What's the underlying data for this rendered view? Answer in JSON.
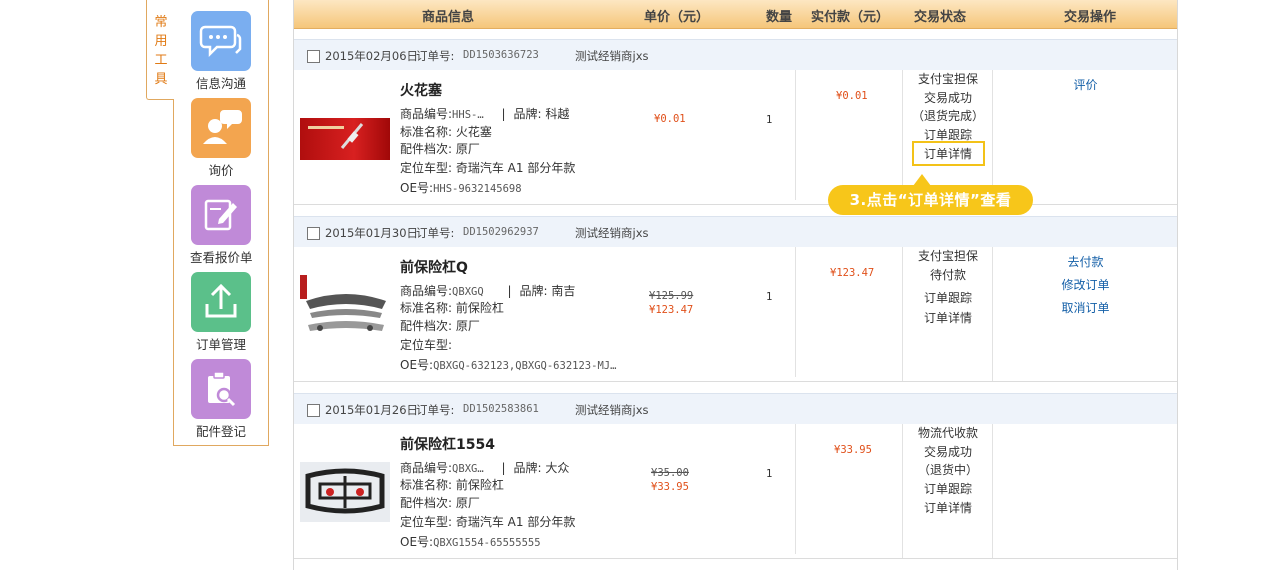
{
  "tools": {
    "tab_label": "常用工具",
    "items": [
      {
        "label": "信息沟通",
        "icon": "chat-icon",
        "color": "#7aaef0"
      },
      {
        "label": "询价",
        "icon": "inquiry-icon",
        "color": "#f3a54f"
      },
      {
        "label": "查看报价单",
        "icon": "edit-icon",
        "color": "#c08ad8"
      },
      {
        "label": "订单管理",
        "icon": "upload-icon",
        "color": "#5bc08a"
      },
      {
        "label": "配件登记",
        "icon": "clipboard-search-icon",
        "color": "#c08ad8"
      }
    ]
  },
  "table": {
    "headers": [
      "商品信息",
      "单价（元）",
      "数量",
      "实付款（元）",
      "交易状态",
      "交易操作"
    ]
  },
  "orders": [
    {
      "date": "2015年02月06日",
      "order_no_label": "订单号:",
      "order_no": "DD1503636723",
      "dealer": "测试经销商jxs",
      "product": {
        "name": "火花塞",
        "code_label": "商品编号:",
        "code": "HHS-…",
        "brand_label": "品牌:",
        "brand": "科越",
        "std_name": "标准名称: 火花塞",
        "grade": "配件档次: 原厂",
        "vehicle": "定位车型: 奇瑞汽车 A1 部分年款",
        "oe_label": "OE号:",
        "oe": "HHS-9632145698"
      },
      "price_original": "",
      "price": "¥0.01",
      "qty": "1",
      "paid": "¥0.01",
      "status": [
        "支付宝担保",
        "交易成功",
        "（退货完成）",
        "订单跟踪",
        "订单详情"
      ],
      "ops": [
        "评价"
      ]
    },
    {
      "date": "2015年01月30日",
      "order_no_label": "订单号:",
      "order_no": "DD1502962937",
      "dealer": "测试经销商jxs",
      "product": {
        "name": "前保险杠Q",
        "code_label": "商品编号:",
        "code": "QBXGQ",
        "brand_label": "品牌:",
        "brand": "南吉",
        "std_name": "标准名称: 前保险杠",
        "grade": "配件档次: 原厂",
        "vehicle": "定位车型:",
        "oe_label": "OE号:",
        "oe": "QBXGQ-632123,QBXGQ-632123-MJ…"
      },
      "price_original": "¥125.99",
      "price": "¥123.47",
      "qty": "1",
      "paid": "¥123.47",
      "status": [
        "支付宝担保",
        "待付款",
        "订单跟踪",
        "订单详情"
      ],
      "ops": [
        "去付款",
        "修改订单",
        "取消订单"
      ]
    },
    {
      "date": "2015年01月26日",
      "order_no_label": "订单号:",
      "order_no": "DD1502583861",
      "dealer": "测试经销商jxs",
      "product": {
        "name": "前保险杠1554",
        "code_label": "商品编号:",
        "code": "QBXG…",
        "brand_label": "品牌:",
        "brand": "大众",
        "std_name": "标准名称: 前保险杠",
        "grade": "配件档次: 原厂",
        "vehicle": "定位车型: 奇瑞汽车 A1 部分年款",
        "oe_label": "OE号:",
        "oe": "QBXG1554-65555555"
      },
      "price_original": "¥35.00",
      "price": "¥33.95",
      "qty": "1",
      "paid": "¥33.95",
      "status": [
        "物流代收款",
        "交易成功",
        "（退货中）",
        "订单跟踪",
        "订单详情"
      ],
      "ops": []
    }
  ],
  "annotation": {
    "callout_text": "3.点击“订单详情”查看"
  }
}
